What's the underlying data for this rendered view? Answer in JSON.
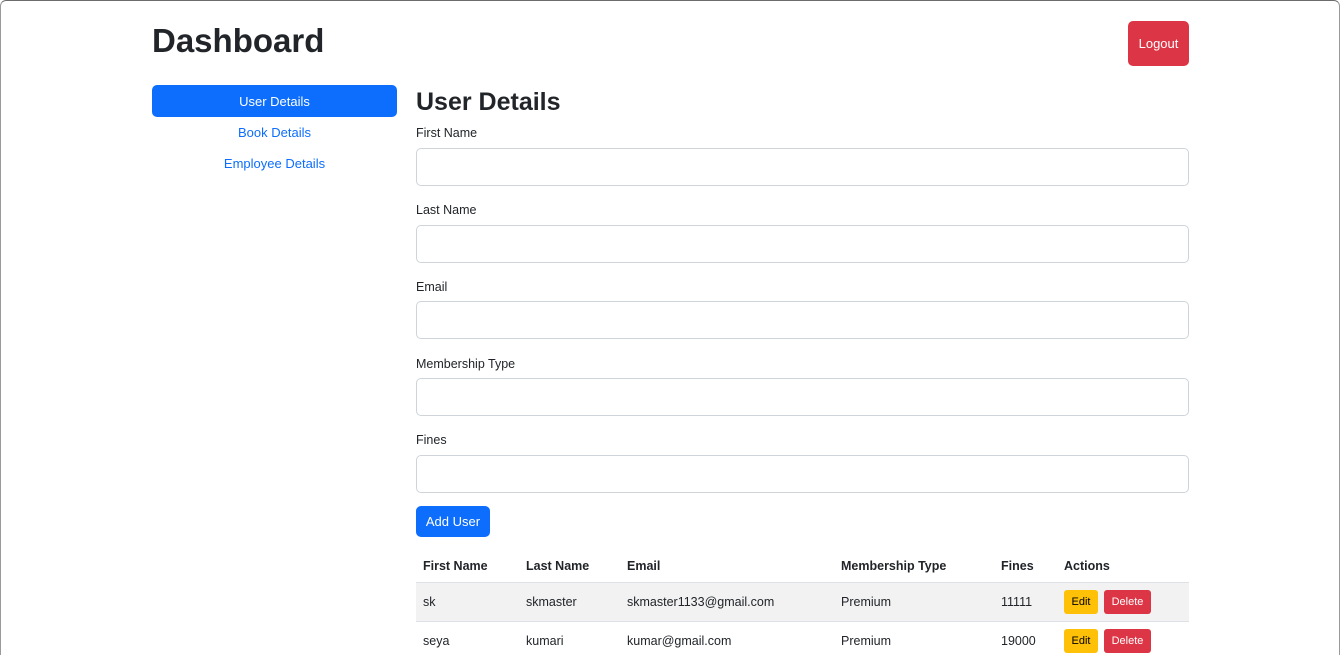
{
  "header": {
    "title": "Dashboard",
    "logout_label": "Logout"
  },
  "sidebar": {
    "items": [
      {
        "label": "User Details",
        "active": true
      },
      {
        "label": "Book Details",
        "active": false
      },
      {
        "label": "Employee Details",
        "active": false
      }
    ]
  },
  "main": {
    "title": "User Details",
    "form": {
      "fields": [
        {
          "label": "First Name",
          "value": ""
        },
        {
          "label": "Last Name",
          "value": ""
        },
        {
          "label": "Email",
          "value": ""
        },
        {
          "label": "Membership Type",
          "value": ""
        },
        {
          "label": "Fines",
          "value": ""
        }
      ],
      "submit_label": "Add User"
    },
    "table": {
      "headers": [
        "First Name",
        "Last Name",
        "Email",
        "Membership Type",
        "Fines",
        "Actions"
      ],
      "rows": [
        {
          "first_name": "sk",
          "last_name": "skmaster",
          "email": "skmaster1133@gmail.com",
          "membership": "Premium",
          "fines": "11111"
        },
        {
          "first_name": "seya",
          "last_name": "kumari",
          "email": "kumar@gmail.com",
          "membership": "Premium",
          "fines": "19000"
        }
      ],
      "edit_label": "Edit",
      "delete_label": "Delete"
    }
  },
  "colors": {
    "primary": "#0d6efd",
    "danger": "#dc3545",
    "warning": "#ffc107"
  }
}
